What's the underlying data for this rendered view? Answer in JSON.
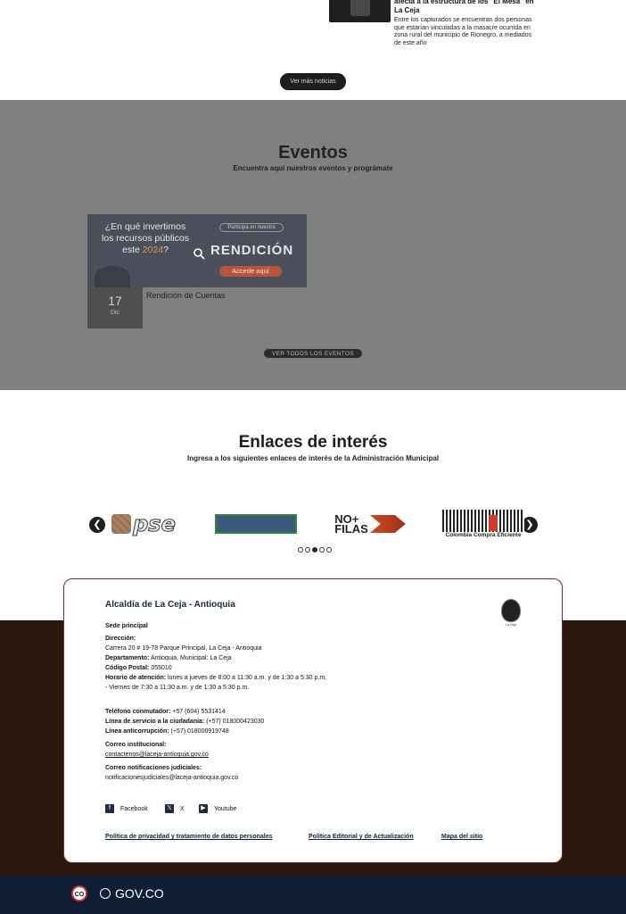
{
  "news": {
    "title": "afecta a la estructura de los \"El Mesa\" en La Ceja",
    "desc": "Entre los capturados se encuentran dos personas que estarían vinculadas a la masacre ocurrida en zona rural del municipio de Rionegro, a mediados de este año",
    "more_button": "Ver más noticias"
  },
  "events": {
    "title": "Eventos",
    "subtitle": "Encuentra aquí nuestros eventos y prográmate",
    "banner": {
      "question_1": "¿En qué invertimos",
      "question_2": "los recursos públicos",
      "question_3": "este",
      "year": "2024",
      "question_end": "?",
      "pill": "Participa en nuestra",
      "big": "RENDICIÓN",
      "access": "Accede aquí"
    },
    "items": [
      {
        "day": "17",
        "month": "Dic",
        "name": "Rendición de Cuentas"
      }
    ],
    "all_button": "VER TODOS LOS EVENTOS"
  },
  "links": {
    "title": "Enlaces de interés",
    "subtitle": "Ingresa a los siguientes enlaces de interés de la Administración Municipal",
    "logos": {
      "pse": "pse",
      "nofilas_1": "NO+",
      "nofilas_2": "FILAS",
      "cce": "Colombia Compra Eficiente"
    },
    "dots": 5,
    "active_dot": 2
  },
  "footer": {
    "title": "Alcaldía de La Ceja - Antioquia",
    "sede": "Sede principal",
    "direccion_label": "Dirección:",
    "direccion": "Carrera 20 # 19-78 Parque Principal, La Ceja - Antioquia",
    "departamento_label": "Departamento:",
    "departamento": "Antioquia, Municipal: La Ceja",
    "codigo_label": "Código Postal:",
    "codigo": "055010",
    "horario_label": "Horario de atención:",
    "horario": "lunes a jueves de 8:00 a 11:30 a.m. y de 1:30 a 5:30 p.m. - Viernes de 7:30 a 11:30 a.m. y de 1:30 a 5:30 p.m.",
    "tel_label": "Teléfono conmutador:",
    "tel": "+57 (604) 5531414",
    "linea_label": "Línea de servicio a la ciudadanía:",
    "linea": "(+57) 018000423030",
    "anticorr_label": "Línea anticorrupción:",
    "anticorr": "(+57) 018000919748",
    "mail_label": "Correo institucional:",
    "mail": "contactenos@laceja-antioquia.gov.co",
    "notif_label": "Correo  notificaciones judiciales:",
    "notif": "notificacionesjudiciales@laceja-antioquia.gov.co",
    "social": {
      "facebook": "Facebook",
      "x": "X",
      "youtube": "Youtube"
    },
    "policies": {
      "privacy": "Política de privacidad y tratamiento de datos personales",
      "editorial": "Política Editorial y de Actualización",
      "sitemap": "Mapa del sitio"
    }
  },
  "govbar": {
    "co": "CO",
    "gov": "GOV.CO"
  }
}
